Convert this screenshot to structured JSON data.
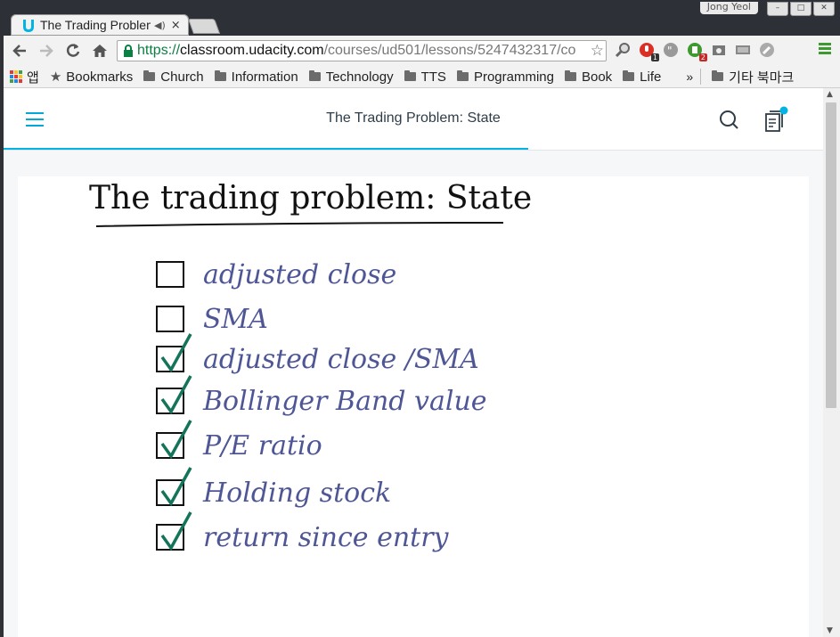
{
  "window": {
    "user_label": "Jong Yeol",
    "controls": [
      "–",
      "□",
      "✕"
    ]
  },
  "tab": {
    "title": "The Trading Problem: State",
    "audio_icon": "◀)",
    "close_glyph": "×"
  },
  "toolbar": {
    "url_scheme": "https://",
    "url_host": "classroom.udacity.com",
    "url_path": "/courses/ud501/lessons/5247432317/co",
    "badges": {
      "ext_red": "1",
      "ext_green": "2"
    }
  },
  "bookmarks": {
    "apps_label": "앱",
    "items": [
      {
        "label": "Bookmarks"
      },
      {
        "label": "Church"
      },
      {
        "label": "Information"
      },
      {
        "label": "Technology"
      },
      {
        "label": "TTS"
      },
      {
        "label": "Programming"
      },
      {
        "label": "Book"
      },
      {
        "label": "Life"
      }
    ],
    "overflow": "»",
    "other_label": "기타 북마크"
  },
  "lesson": {
    "title": "The Trading Problem: State",
    "progress_fraction": 0.64
  },
  "whiteboard": {
    "heading": "The trading problem: State",
    "items": [
      {
        "text": "adjusted close",
        "checked": false
      },
      {
        "text": "SMA",
        "checked": false
      },
      {
        "text": "adjusted close /SMA",
        "checked": true
      },
      {
        "text": "Bollinger Band value",
        "checked": true
      },
      {
        "text": "P/E ratio",
        "checked": true
      },
      {
        "text": "Holding stock",
        "checked": true
      },
      {
        "text": "return since entry",
        "checked": true
      }
    ]
  },
  "colors": {
    "udacity_blue": "#02b3e4",
    "ink_blue": "#4e5696",
    "check_green": "#13745a"
  }
}
